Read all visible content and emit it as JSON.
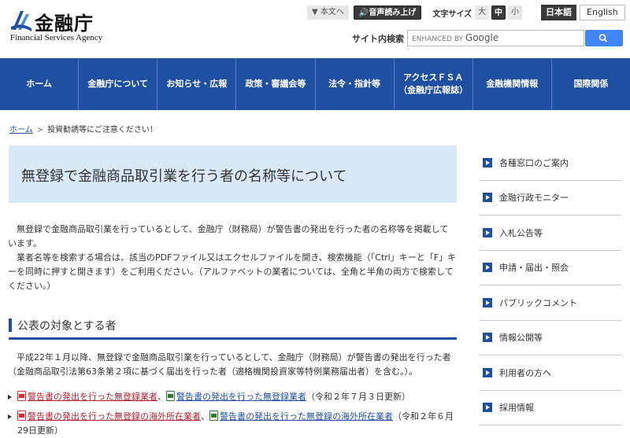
{
  "header": {
    "logo_title": "金融庁",
    "logo_subtitle": "Financial Services Agency",
    "skip_to_body": "▼ 本文へ",
    "read_aloud": "音声読み上げ",
    "font_size_label": "文字サイズ",
    "font_sizes": [
      "大",
      "中",
      "小"
    ],
    "lang_japanese": "日本語",
    "lang_english": "English",
    "site_search_label": "サイト内検索",
    "search_enhanced": "ENHANCED BY ",
    "search_google": "Google"
  },
  "nav": {
    "items": [
      "ホーム",
      "金融庁について",
      "お知らせ・広報",
      "政策・審議会等",
      "法令・指針等",
      "アクセスＦＳＡ\n（金融庁広報誌）",
      "金融機関情報",
      "国際関係"
    ]
  },
  "breadcrumb": {
    "home": "ホーム",
    "separator": ">",
    "current": "投資勧誘等にご注意ください！"
  },
  "main": {
    "title": "無登録で金融商品取引業を行う者の名称等について",
    "intro": [
      "無登録で金融商品取引業を行っているとして、金融庁（財務局）が警告書の発出を行った者の名称等を掲載しています。",
      "業者名等を検索する場合は、該当のPDFファイル又はエクセルファイルを開き、検索機能（「Ctrl」キーと「F」キーを同時に押すと開きます）をご利用ください。（アルファベットの業者については、全角と半角の両方で検索してください。）"
    ],
    "section_heading": "公表の対象とする者",
    "section_body": "平成22年１月以降、無登録で金融商品取引業を行っているとして、金融庁（財務局）が警告書の発出を行った者（金融商品取引法第63条第２項に基づく届出を行った者（適格機関投資家等特例業務届出者）を含む。）。",
    "links": [
      {
        "pdf_text": "警告書の発出を行った無登録業者",
        "sep": "、",
        "xls_text": "警告書の発出を行った無登録業者",
        "note": "（令和２年７月３日更新）"
      },
      {
        "pdf_text": "警告書の発出を行った無登録の海外所在業者",
        "sep": "、",
        "xls_text": "警告書の発出を行った無登録の海外所在業者",
        "note": "（令和２年６月29日更新）"
      }
    ]
  },
  "sidebar": {
    "items": [
      "各種窓口のご案内",
      "金融行政モニター",
      "入札公告等",
      "申請・届出・照会",
      "パブリックコメント",
      "情報公開等",
      "利用者の方へ",
      "採用情報"
    ]
  },
  "colors": {
    "nav_bg": "#1e4fa1",
    "title_box_bg": "#d9e8f6",
    "link": "#1e4fa1",
    "pdf_link": "#b3232d",
    "search_button": "#4285f4"
  }
}
